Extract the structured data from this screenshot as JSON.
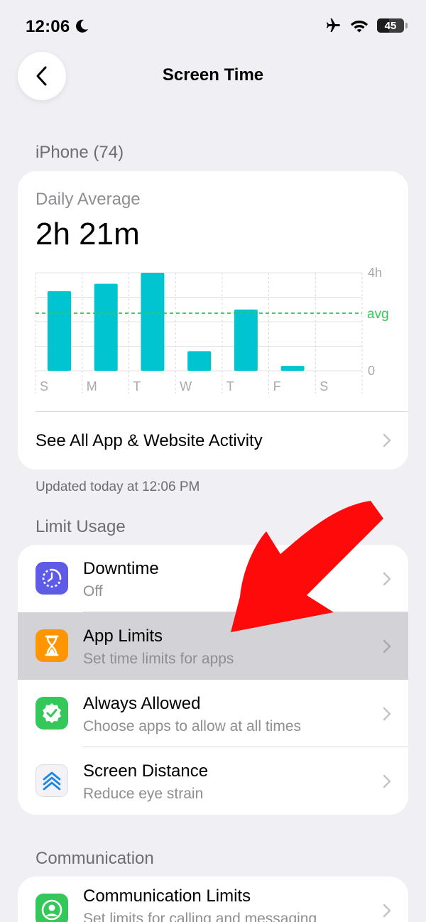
{
  "status_bar": {
    "time": "12:06",
    "battery": "45",
    "icons": [
      "moon-icon",
      "airplane-icon",
      "wifi-icon",
      "battery-icon"
    ]
  },
  "nav": {
    "title": "Screen Time",
    "back_icon": "chevron-left-icon"
  },
  "device_section": {
    "header": "iPhone (74)",
    "daily_label": "Daily Average",
    "daily_value": "2h 21m",
    "see_all_label": "See All App & Website Activity",
    "updated": "Updated today at 12:06 PM"
  },
  "chart_data": {
    "type": "bar",
    "categories": [
      "S",
      "M",
      "T",
      "W",
      "T",
      "F",
      "S"
    ],
    "values": [
      3.25,
      3.55,
      4.0,
      0.8,
      2.5,
      0.2,
      0
    ],
    "avg_label": "avg",
    "avg_value": 2.35,
    "y_ticks": [
      "4h",
      "0"
    ],
    "ylim": [
      0,
      4
    ],
    "bar_color": "#00c5d0",
    "avg_color": "#34c759",
    "grid": true
  },
  "limit_section": {
    "header": "Limit Usage",
    "rows": [
      {
        "title": "Downtime",
        "subtitle": "Off",
        "icon": "downtime-icon",
        "icon_color": "#5e5ce6"
      },
      {
        "title": "App Limits",
        "subtitle": "Set time limits for apps",
        "icon": "hourglass-icon",
        "icon_color": "#ff9500"
      },
      {
        "title": "Always Allowed",
        "subtitle": "Choose apps to allow at all times",
        "icon": "checkmark-badge-icon",
        "icon_color": "#34c759"
      },
      {
        "title": "Screen Distance",
        "subtitle": "Reduce eye strain",
        "icon": "screen-distance-icon",
        "icon_color": "#f2f2f7"
      }
    ]
  },
  "communication_section": {
    "header": "Communication",
    "rows": [
      {
        "title": "Communication Limits",
        "subtitle": "Set limits for calling and messaging",
        "icon": "person-circle-icon",
        "icon_color": "#34c759"
      }
    ]
  },
  "annotation": {
    "arrow_color": "#ff0000",
    "arrow_icon": "red-arrow-annotation"
  }
}
